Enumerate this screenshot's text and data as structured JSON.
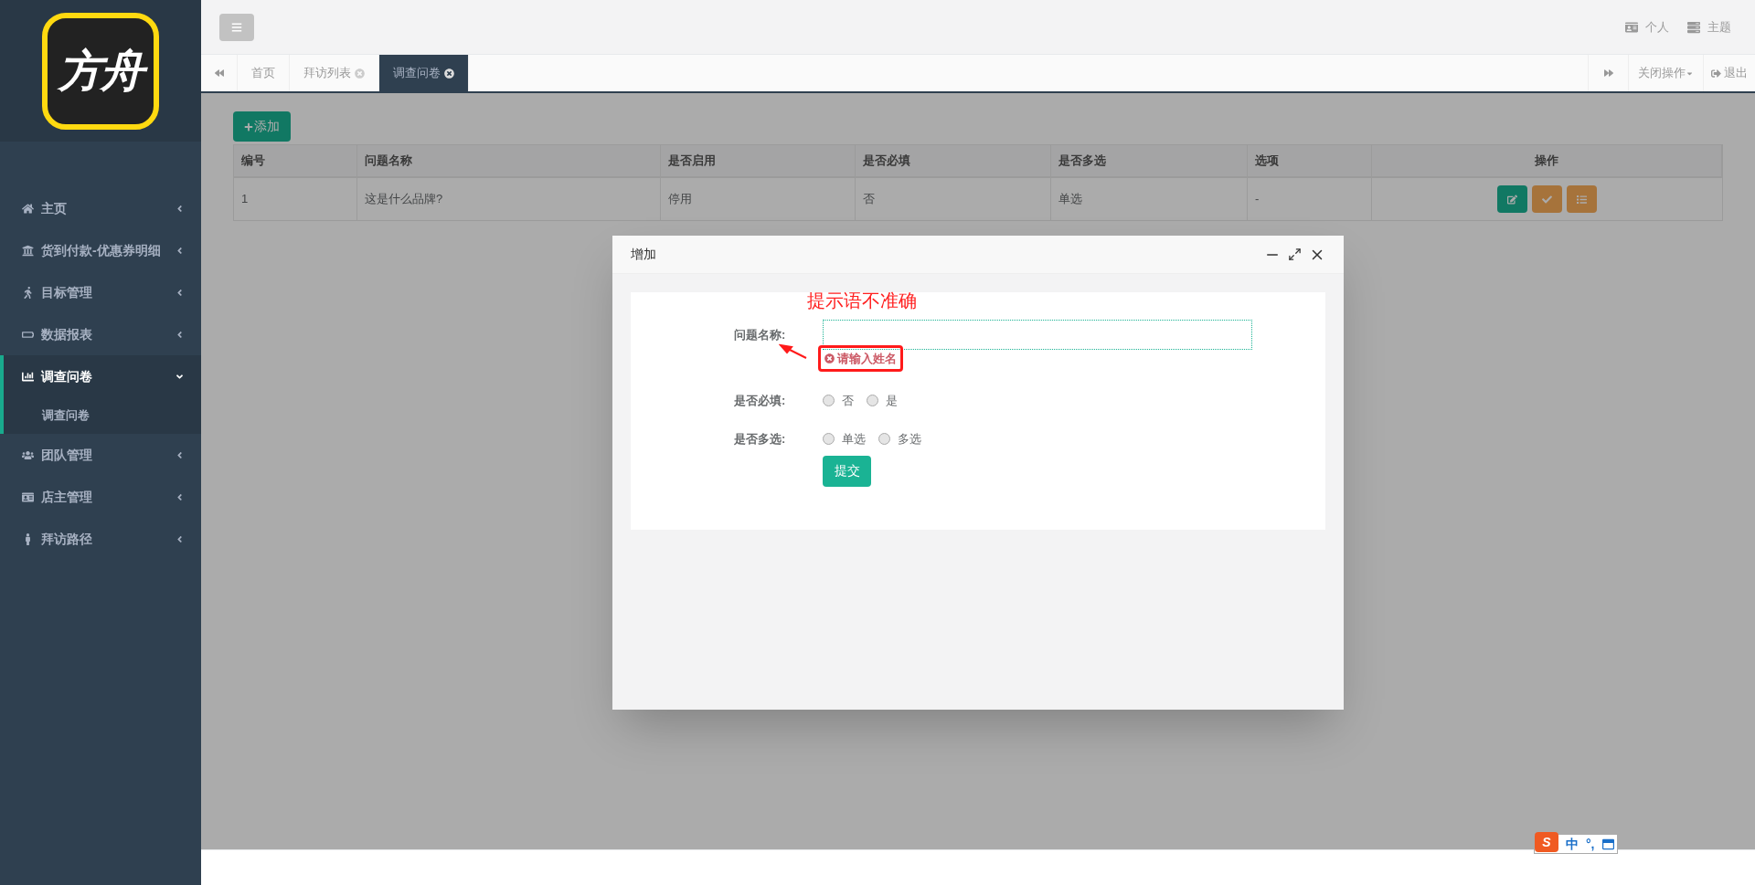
{
  "sidebar": {
    "logo_text": "方舟",
    "items": [
      {
        "label": "主页",
        "expanded": false,
        "selected": false
      },
      {
        "label": "货到付款-优惠券明细",
        "expanded": false,
        "selected": false
      },
      {
        "label": "目标管理",
        "expanded": false,
        "selected": false
      },
      {
        "label": "数据报表",
        "expanded": false,
        "selected": false
      },
      {
        "label": "调查问卷",
        "expanded": true,
        "selected": true,
        "children": [
          {
            "label": "调查问卷",
            "selected": false
          }
        ]
      },
      {
        "label": "团队管理",
        "expanded": false,
        "selected": false
      },
      {
        "label": "店主管理",
        "expanded": false,
        "selected": false
      },
      {
        "label": "拜访路径",
        "expanded": false,
        "selected": false
      }
    ]
  },
  "topbar": {
    "links": [
      {
        "label": "个人"
      },
      {
        "label": "主题"
      }
    ]
  },
  "tabs": [
    {
      "label": "首页",
      "selected": false,
      "closable": false
    },
    {
      "label": "拜访列表",
      "selected": false,
      "closable": true
    },
    {
      "label": "调查问卷",
      "selected": true,
      "closable": true
    }
  ],
  "tab_actions": {
    "close_menu": "关闭操作",
    "logout": "退出"
  },
  "add_button": "添加",
  "table": {
    "columns": [
      "编号",
      "问题名称",
      "是否启用",
      "是否必填",
      "是否多选",
      "选项",
      "操作"
    ],
    "rows": [
      {
        "cells": [
          "1",
          "这是什么品牌?",
          "停用",
          "否",
          "单选",
          "-"
        ],
        "actions": [
          {
            "kind": "edit"
          },
          {
            "kind": "check"
          },
          {
            "kind": "list"
          }
        ]
      }
    ]
  },
  "dialog": {
    "title": "增加",
    "annotation": "提示语不准确",
    "fields": [
      {
        "kind": "text",
        "label": "问题名称:",
        "error": "请输入姓名"
      },
      {
        "kind": "radio",
        "label": "是否必填:",
        "options": [
          {
            "label": "否",
            "selected": false
          },
          {
            "label": "是",
            "selected": false
          }
        ]
      },
      {
        "kind": "radio",
        "label": "是否多选:",
        "options": [
          {
            "label": "单选",
            "selected": false
          },
          {
            "label": "多选",
            "selected": false
          }
        ]
      }
    ],
    "submit": "提交"
  },
  "ime": {
    "logo": "S",
    "mode": "中",
    "punct": "°,"
  }
}
